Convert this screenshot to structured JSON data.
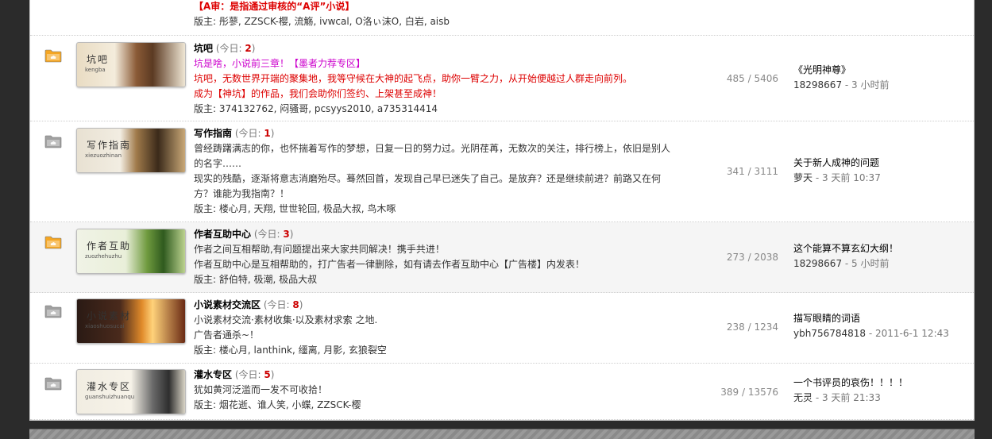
{
  "top_partial": {
    "line1": "【A审：是指通过审核的“A评”小说】",
    "mods_label": "版主:",
    "mods": "彤蓼, ZZSCK-樱, 流觞, ivwcal, O洛ぃ沫O, 白岩, aisb"
  },
  "forums": [
    {
      "name": "坑吧",
      "today_label": "(今日: ",
      "today_count": "2",
      "today_close": ")",
      "thumb_title": "坑吧",
      "thumb_sub": "kengba",
      "desc_lines": [
        {
          "text": "坑是啥，小说前三章！【墨者力荐专区】",
          "cls": "pink"
        },
        {
          "text": "坑吧，无数世界开端的聚集地，我等守候在大神的起飞点，助你一臂之力，从开始便越过人群走向前列。",
          "cls": "red"
        },
        {
          "text": "成为【神坑】的作品，我们会助你们签约、上架甚至成神！",
          "cls": "red"
        }
      ],
      "mods_label": "版主:",
      "mods": "374132762, 闷骚哥, pcsyys2010, a735314414",
      "stats": "485 / 5406",
      "last_title": "《光明神尊》",
      "last_author": "18298667",
      "last_time": "3 小时前",
      "active": true
    },
    {
      "name": "写作指南",
      "today_label": "(今日: ",
      "today_count": "1",
      "today_close": ")",
      "thumb_title": "写作指南",
      "thumb_sub": "xiezuozhinan",
      "desc_lines": [
        {
          "text": "曾经踌躇满志的你，也怀揣着写作的梦想，日复一日的努力过。光阴荏苒，无数次的关注，排行榜上，依旧是别人的名字……",
          "cls": "desc"
        },
        {
          "text": "现实的残酷，逐渐将意志消磨殆尽。蓦然回首，发现自己早已迷失了自己。是放弃？还是继续前进？前路又在何方？谁能为我指南？！",
          "cls": "desc"
        }
      ],
      "mods_label": "版主:",
      "mods": "楼心月, 天翔, 世世轮回, 极品大叔, 鸟木啄",
      "stats": "341 / 3111",
      "last_title": "关于新人成神的问题",
      "last_author": "萝天",
      "last_time": "3 天前 10:37",
      "active": false
    },
    {
      "name": "作者互助中心",
      "today_label": "(今日: ",
      "today_count": "3",
      "today_close": ")",
      "thumb_title": "作者互助",
      "thumb_sub": "zuozhehuzhu",
      "desc_lines": [
        {
          "text": "作者之间互相帮助,有问题提出来大家共同解决！携手共进！",
          "cls": "desc"
        },
        {
          "text": "作者互助中心是互相帮助的，打广告者一律删除，如有请去作者互助中心【广告楼】内发表！",
          "cls": "desc"
        }
      ],
      "mods_label": "版主:",
      "mods": "舒伯特, 极潮, 极品大叔",
      "stats": "273 / 2038",
      "last_title": "这个能算不算玄幻大纲！",
      "last_author": "18298667",
      "last_time": "5 小时前",
      "active": true
    },
    {
      "name": "小说素材交流区",
      "today_label": "(今日: ",
      "today_count": "8",
      "today_close": ")",
      "thumb_title": "小说素材",
      "thumb_sub": "xiaoshuosucai",
      "desc_lines": [
        {
          "text": "小说素材交流·素材收集·以及素材求索 之地.",
          "cls": "desc"
        },
        {
          "text": "广告者通杀~！",
          "cls": "desc"
        }
      ],
      "mods_label": "版主:",
      "mods": "楼心月, lanthink, 缰离, 月影, 玄狼裂空",
      "stats": "238 / 1234",
      "last_title": "描写眼睛的词语",
      "last_author": "ybh756784818",
      "last_time": "2011-6-1 12:43",
      "active": false
    },
    {
      "name": "灌水专区",
      "today_label": "(今日: ",
      "today_count": "5",
      "today_close": ")",
      "thumb_title": "灌水专区",
      "thumb_sub": "guanshuizhuanqu",
      "desc_lines": [
        {
          "text": "犹如黄河泛滥而一发不可收拾！",
          "cls": "desc"
        }
      ],
      "mods_label": "版主:",
      "mods": "烟花逝、谁人笑, 小蝶, ZZSCK-樱",
      "stats": "389 / 13576",
      "last_title": "一个书评员的哀伤！！！！",
      "last_author": "无灵",
      "last_time": "3 天前 21:33",
      "active": false
    }
  ],
  "sep": " - ",
  "colors": {
    "active_folder": "#f5a623",
    "inactive_folder": "#a0a0a0"
  }
}
